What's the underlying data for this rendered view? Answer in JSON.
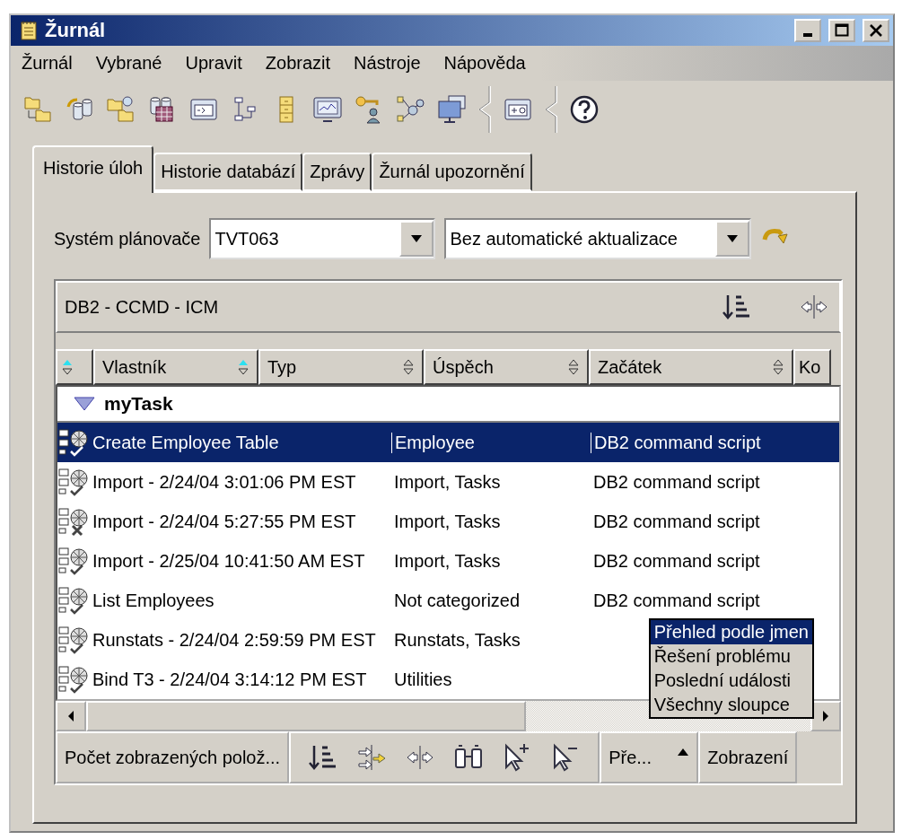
{
  "window": {
    "title": "Žurnál"
  },
  "menu": [
    "Žurnál",
    "Vybrané",
    "Upravit",
    "Zobrazit",
    "Nástroje",
    "Nápověda"
  ],
  "tabs": [
    {
      "label": "Historie úloh",
      "selected": true
    },
    {
      "label": "Historie databází",
      "selected": false
    },
    {
      "label": "Zprávy",
      "selected": false
    },
    {
      "label": "Žurnál upozornění",
      "selected": false
    }
  ],
  "scheduler": {
    "label": "Systém plánovače",
    "value": "TVT063",
    "refresh": "Bez automatické aktualizace"
  },
  "table": {
    "title": "DB2 - CCMD - ICM",
    "header_buttons": [
      {
        "sort_active": true
      },
      {
        "label": "Vlastník",
        "sort_active": true
      },
      {
        "label": "Typ",
        "sort_active": false
      },
      {
        "label": "Úspěch",
        "sort_active": false
      },
      {
        "label": "Začátek",
        "sort_active": false
      },
      {
        "label": "Ko"
      }
    ],
    "group": {
      "label": "myTask",
      "expanded": true
    },
    "task_rows": [
      {
        "cells": [
          "Create Employee Table",
          "Employee",
          "DB2 command script"
        ],
        "failed": false,
        "selected": true
      },
      {
        "cells": [
          "Import - 2/24/04 3:01:06 PM EST",
          "Import, Tasks",
          "DB2 command script"
        ],
        "failed": false,
        "selected": false
      },
      {
        "cells": [
          "Import - 2/24/04 5:27:55 PM EST",
          "Import, Tasks",
          "DB2 command script"
        ],
        "failed": true,
        "selected": false
      },
      {
        "cells": [
          "Import - 2/25/04 10:41:50 AM EST",
          "Import, Tasks",
          "DB2 command script"
        ],
        "failed": false,
        "selected": false
      },
      {
        "cells": [
          "List Employees",
          "Not categorized",
          "DB2 command script"
        ],
        "failed": false,
        "selected": false
      },
      {
        "cells": [
          "Runstats - 2/24/04 2:59:59 PM EST",
          "Runstats, Tasks"
        ],
        "failed": false,
        "selected": false
      },
      {
        "cells": [
          "Bind T3 - 2/24/04 3:14:12 PM EST",
          "Utilities"
        ],
        "failed": false,
        "selected": false
      }
    ]
  },
  "footer": {
    "count": "Počet zobrazených polož...",
    "views": "Pře...",
    "display": "Zobrazení"
  },
  "popup_menu": [
    {
      "label": "Přehled podle jmen",
      "selected": true
    },
    {
      "label": "Řešení problému",
      "selected": false
    },
    {
      "label": "Poslední události",
      "selected": false
    },
    {
      "label": "Všechny sloupce",
      "selected": false
    }
  ]
}
